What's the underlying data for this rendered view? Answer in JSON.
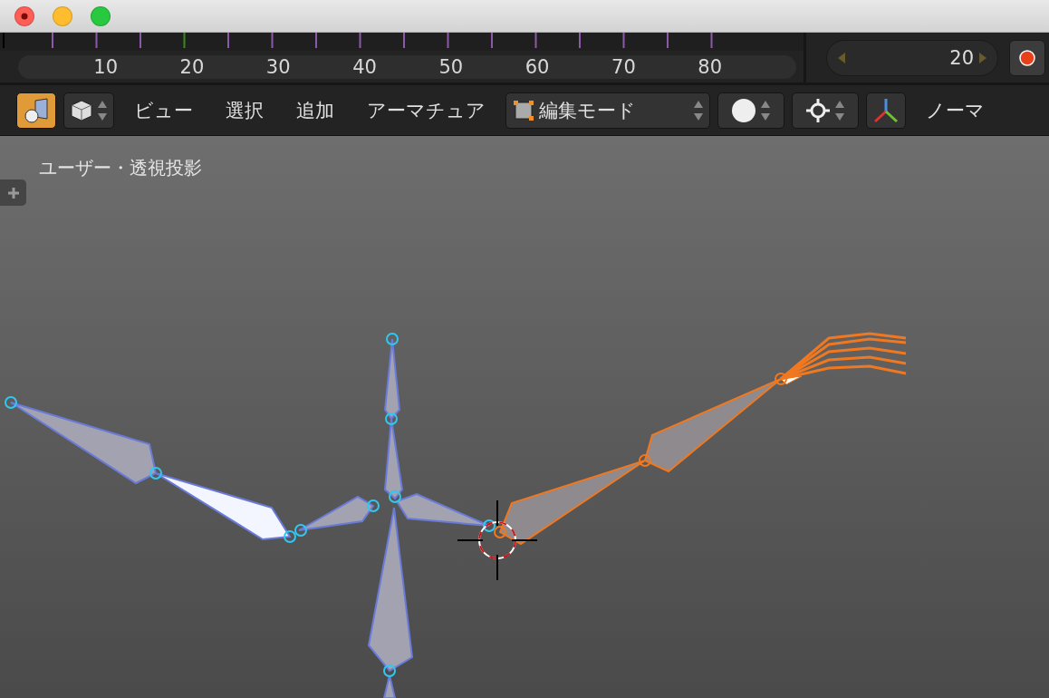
{
  "timeline": {
    "ruler_labels": [
      "10",
      "20",
      "30",
      "40",
      "50",
      "60",
      "70",
      "80"
    ],
    "current_frame": "20"
  },
  "header": {
    "menus": [
      "ビュー",
      "選択",
      "追加",
      "アーマチュア"
    ],
    "mode": "編集モード",
    "overflow_label": "ノーマ"
  },
  "viewport": {
    "label": "ユーザー・透視投影"
  }
}
